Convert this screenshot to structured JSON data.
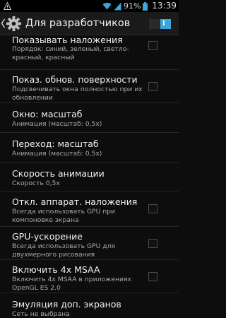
{
  "status_bar": {
    "battery": "91%",
    "time": "13:39",
    "icons": [
      "warning-icon",
      "wifi-icon",
      "signal-icon",
      "battery-icon"
    ]
  },
  "action_bar": {
    "title": "Для разработчиков",
    "switch_label": "I",
    "switch_on": true,
    "icons": [
      "back-chevron-icon",
      "settings-gear-icon"
    ]
  },
  "settings": [
    {
      "title": "Показывать наложения",
      "summary": "Порядок: синий, зеленый, светло-красный, красный",
      "checkbox": false
    },
    {
      "title": "Показ. обнов. поверхности",
      "summary": "Подсвечивать окна полностью при их обновлении",
      "checkbox": false
    },
    {
      "title": "Окно: масштаб",
      "summary": "Анимация (масштаб: 0,5x)"
    },
    {
      "title": "Переход: масштаб",
      "summary": "Анимация (масштаб: 0,5x)"
    },
    {
      "title": "Скорость анимации",
      "summary": "Скорость 0,5x"
    },
    {
      "title": "Откл. аппарат. наложения",
      "summary": "Всегда использовать GPU при компоновке экрана",
      "checkbox": false
    },
    {
      "title": "GPU-ускорение",
      "summary": "Всегда использовать GPU для двухмерного рисования",
      "checkbox": false
    },
    {
      "title": "Включить 4x MSAA",
      "summary": "Включить 4x MSAA в приложениях OpenGL ES 2.0",
      "checkbox": false
    },
    {
      "title": "Эмуляция доп. экранов",
      "summary": "Сеть не выбрана"
    }
  ],
  "colors": {
    "accent": "#3aa6d7",
    "background": "#0d0d0d",
    "action_bar": "#1a1a1a",
    "summary_text": "#a8a8a8"
  }
}
